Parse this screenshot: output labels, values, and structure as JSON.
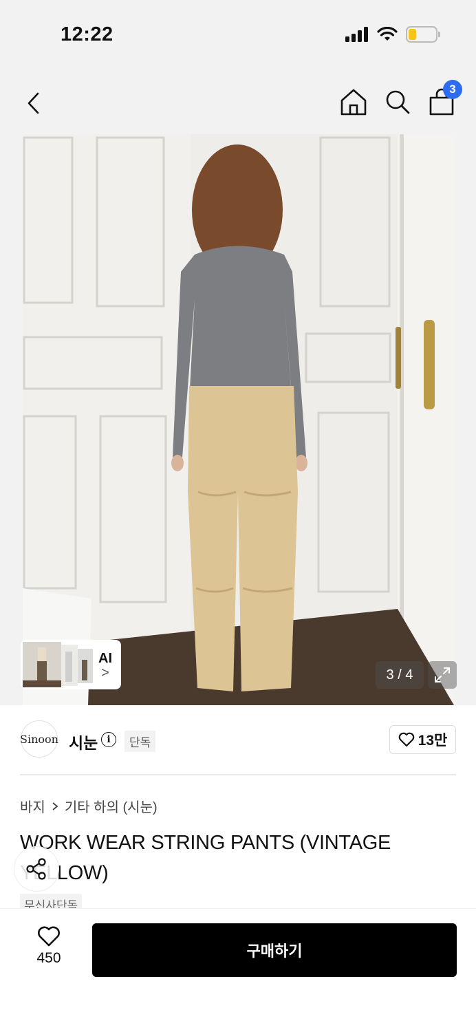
{
  "status_bar": {
    "time": "12:22",
    "battery_level": 0.3
  },
  "nav": {
    "cart_count": "3"
  },
  "gallery": {
    "thumb_label": "AI",
    "thumb_chevron": ">",
    "page_counter": "3 / 4"
  },
  "brand": {
    "logo_text": "Sinoon",
    "name": "시눈",
    "info_icon": "i",
    "badge": "단독",
    "likes": "13만"
  },
  "breadcrumb": [
    "바지",
    "기타 하의 (시눈)"
  ],
  "product": {
    "title": "WORK WEAR STRING PANTS (VINTAGE YELLOW)",
    "tag": "무신사단독"
  },
  "bottom_bar": {
    "wish_count": "450",
    "buy_label": "구매하기"
  },
  "colors": {
    "accent": "#2d6cf0",
    "buy_button": "#000000",
    "battery": "#f5c518"
  }
}
